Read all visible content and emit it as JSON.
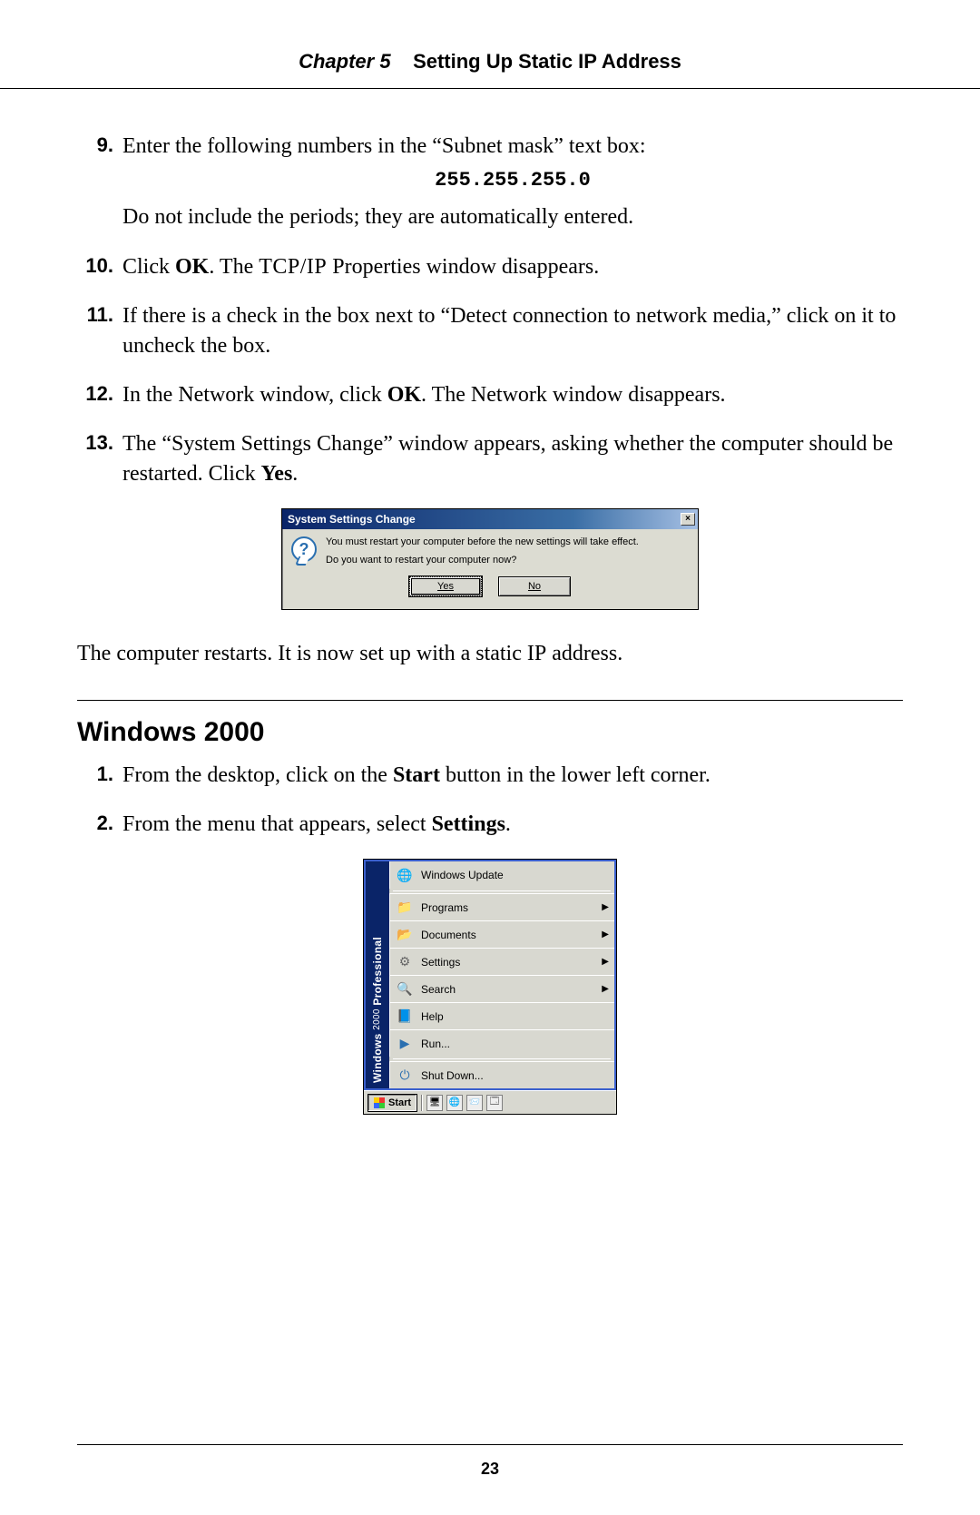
{
  "header": {
    "chapter_label": "Chapter 5",
    "chapter_title": "Setting Up Static IP Address"
  },
  "page_number": "23",
  "steps_a": [
    {
      "num": "9",
      "text_before": "Enter the following numbers in the “Subnet mask” text box:",
      "ip": "255.255.255.0",
      "text_after": "Do not include the periods; they are automatically entered."
    },
    {
      "num": "10",
      "pre": "Click ",
      "bold1": "OK",
      "mid": ". The ",
      "sc": "TCP/IP",
      "post": " Properties window disappears."
    },
    {
      "num": "11",
      "text": "If there is a check in the box next to “Detect connection to network media,” click on it to uncheck the box."
    },
    {
      "num": "12",
      "pre": "In the Network window, click ",
      "bold1": "OK",
      "post": ". The Network window disappears."
    },
    {
      "num": "13",
      "pre": "The “System Settings Change” window appears, asking whether the computer should be restarted. Click ",
      "bold1": "Yes",
      "post": "."
    }
  ],
  "dialog": {
    "title": "System Settings Change",
    "line1": "You must restart your computer before the new settings will take effect.",
    "line2": "Do you want to restart your computer now?",
    "yes": "Yes",
    "no": "No"
  },
  "after_dialog": {
    "pre": "The computer restarts. It is now set up with a static ",
    "sc": "IP",
    "post": " address."
  },
  "section_title": "Windows 2000",
  "steps_b": [
    {
      "num": "1",
      "pre": "From the desktop, click on the ",
      "bold1": "Start",
      "post": " button in the lower left corner."
    },
    {
      "num": "2",
      "pre": "From the menu that appears, select ",
      "bold1": "Settings",
      "post": "."
    }
  ],
  "startmenu": {
    "brand_main": "Windows",
    "brand_year": "2000",
    "brand_edition": "Professional",
    "items": [
      {
        "label": "Windows Update",
        "icon": "globe",
        "arrow": false
      },
      {
        "label": "Programs",
        "icon": "folder",
        "arrow": true
      },
      {
        "label": "Documents",
        "icon": "docs",
        "arrow": true
      },
      {
        "label": "Settings",
        "icon": "gear",
        "arrow": true
      },
      {
        "label": "Search",
        "icon": "search",
        "arrow": true
      },
      {
        "label": "Help",
        "icon": "help",
        "arrow": false
      },
      {
        "label": "Run...",
        "icon": "run",
        "arrow": false
      },
      {
        "label": "Shut Down...",
        "icon": "shut",
        "arrow": false
      }
    ],
    "start_label": "Start"
  }
}
